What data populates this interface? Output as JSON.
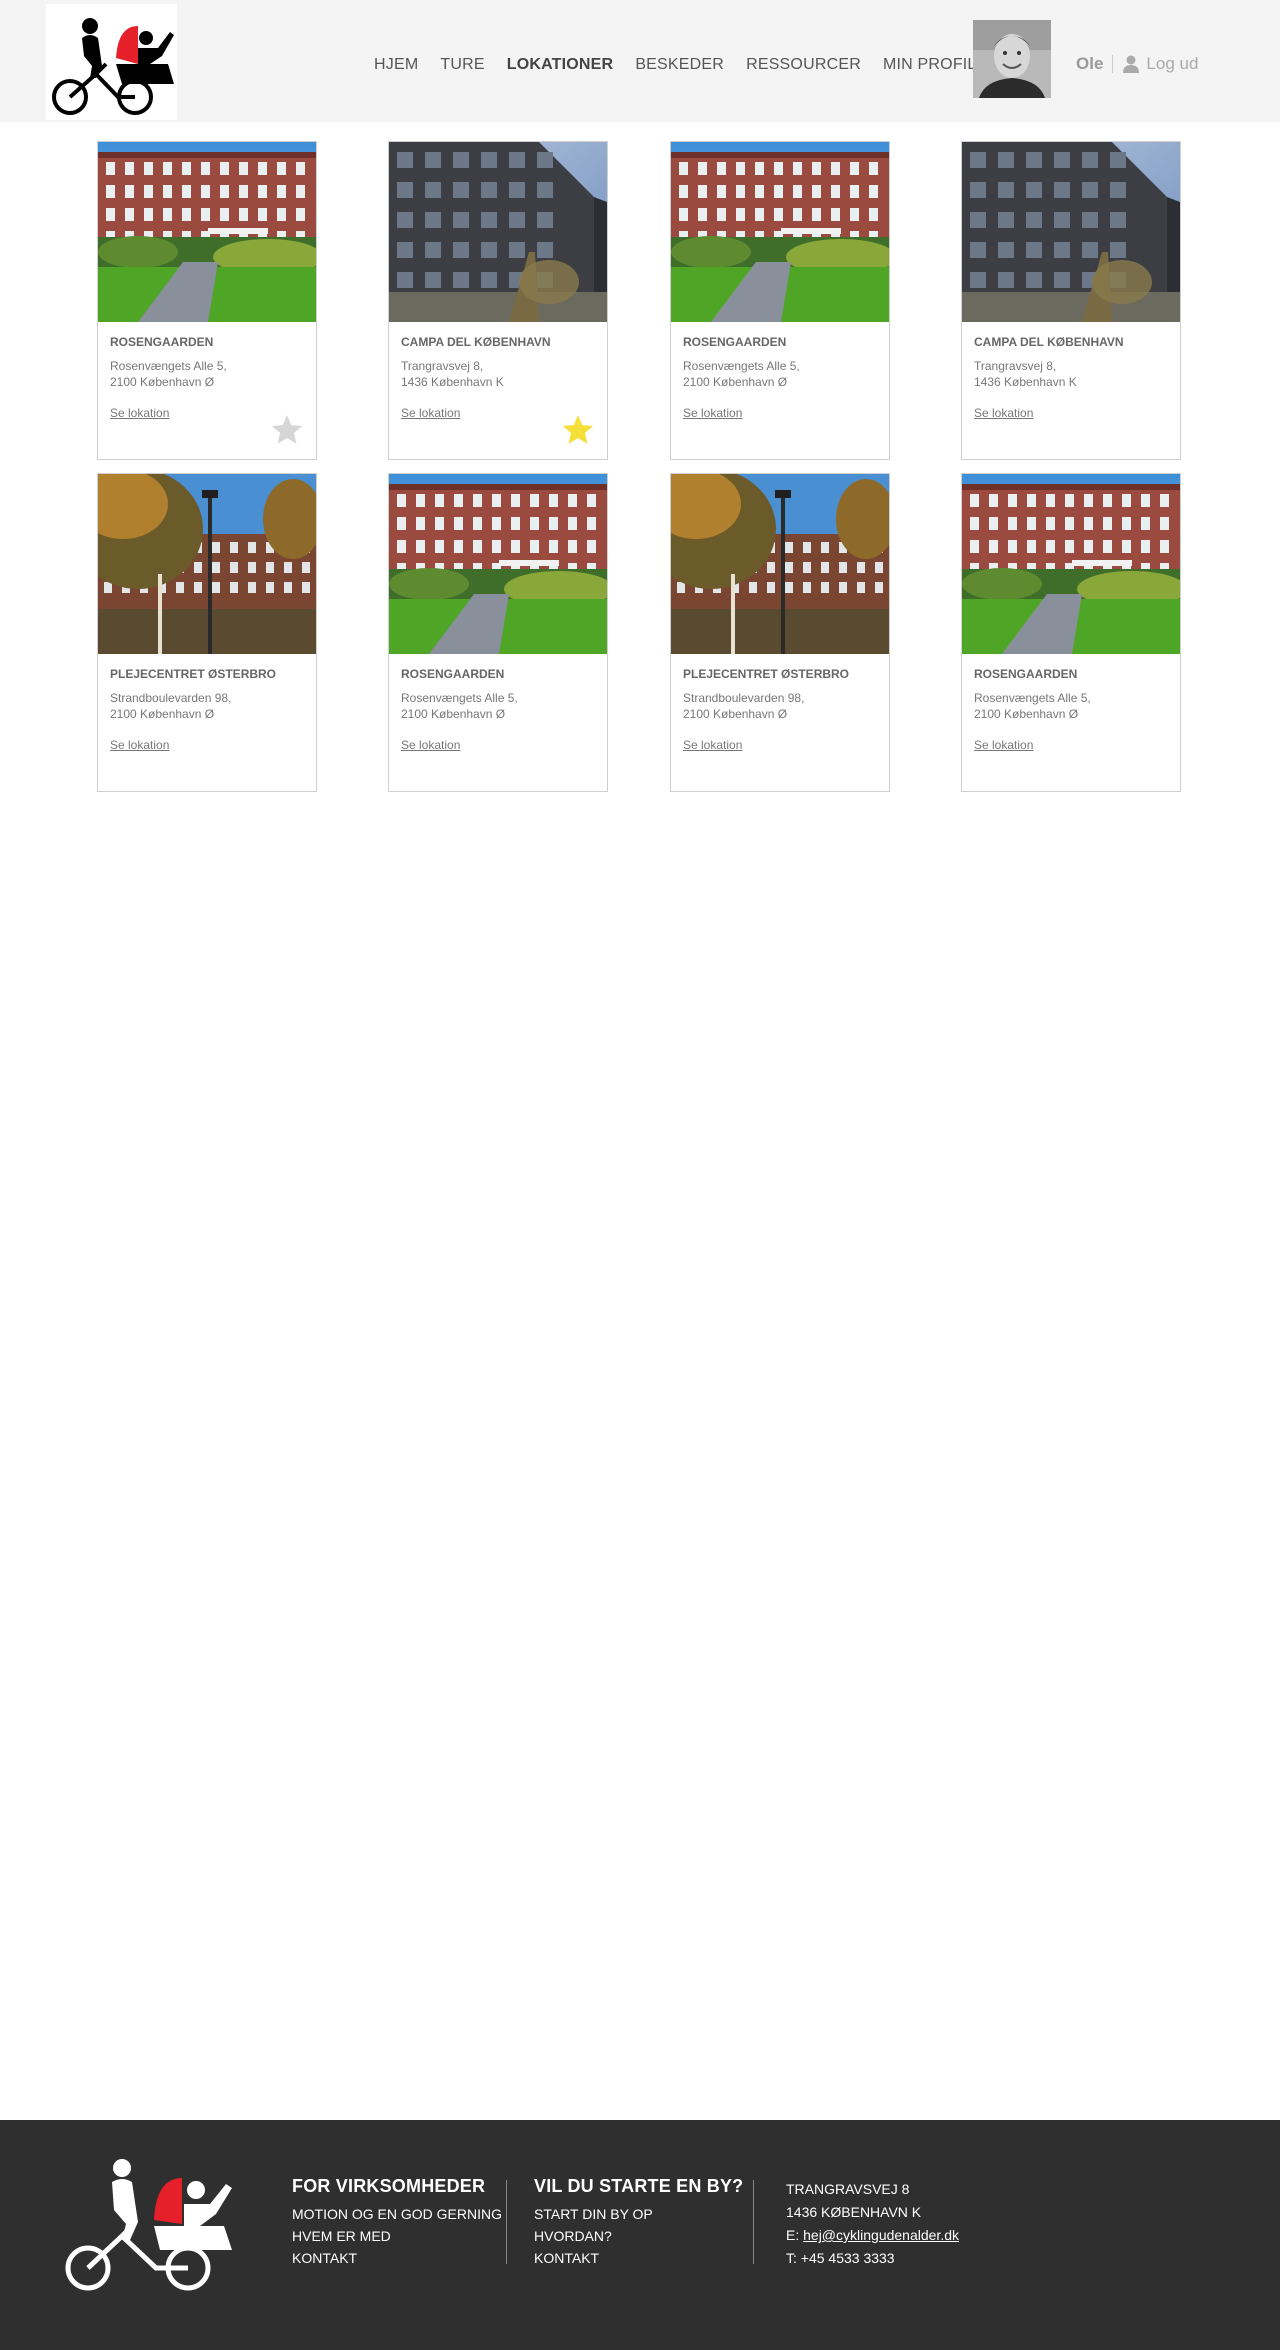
{
  "nav": {
    "items": [
      "HJEM",
      "TURE",
      "LOKATIONER",
      "BESKEDER",
      "RESSOURCER",
      "MIN PROFIL"
    ],
    "active": "LOKATIONER"
  },
  "user": {
    "name": "Ole",
    "logout_label": "Log ud"
  },
  "cards": [
    {
      "name": "ROSENGAARDEN",
      "addr1": "Rosenvængets Alle 5,",
      "addr2": "2100 København Ø",
      "link": "Se lokation",
      "photo": "brick",
      "favorite": "off"
    },
    {
      "name": "CAMPA DEL KØBENHAVN",
      "addr1": "Trangravsvej 8,",
      "addr2": "1436 København K",
      "link": "Se lokation",
      "photo": "modern",
      "favorite": "on"
    },
    {
      "name": "ROSENGAARDEN",
      "addr1": "Rosenvængets Alle 5,",
      "addr2": "2100 København Ø",
      "link": "Se lokation",
      "photo": "brick",
      "favorite": "none"
    },
    {
      "name": "CAMPA DEL KØBENHAVN",
      "addr1": "Trangravsvej 8,",
      "addr2": "1436 København K",
      "link": "Se lokation",
      "photo": "modern",
      "favorite": "none"
    },
    {
      "name": "PLEJECENTRET ØSTERBRO",
      "addr1": "Strandboulevarden 98,",
      "addr2": "2100 København Ø",
      "link": "Se lokation",
      "photo": "autumn",
      "favorite": "none"
    },
    {
      "name": "ROSENGAARDEN",
      "addr1": "Rosenvængets Alle 5,",
      "addr2": "2100 København Ø",
      "link": "Se lokation",
      "photo": "brick",
      "favorite": "none"
    },
    {
      "name": "PLEJECENTRET ØSTERBRO",
      "addr1": "Strandboulevarden 98,",
      "addr2": "2100 København Ø",
      "link": "Se lokation",
      "photo": "autumn",
      "favorite": "none"
    },
    {
      "name": "ROSENGAARDEN",
      "addr1": "Rosenvængets Alle 5,",
      "addr2": "2100 København Ø",
      "link": "Se lokation",
      "photo": "brick",
      "favorite": "none"
    }
  ],
  "footer": {
    "col1": {
      "title": "FOR VIRKSOMHEDER",
      "links": [
        "MOTION OG EN GOD GERNING",
        "HVEM ER MED",
        "KONTAKT"
      ]
    },
    "col2": {
      "title": "VIL DU STARTE EN BY?",
      "links": [
        "START DIN BY OP",
        "HVORDAN?",
        "KONTAKT"
      ]
    },
    "contact": {
      "street": "TRANGRAVSVEJ 8",
      "city": "1436 KØBENHAVN K",
      "email_prefix": "E: ",
      "email": "hej@cyklingudenalder.dk",
      "phone": "T: +45 4533 3333"
    }
  },
  "colors": {
    "star_on": "#f5e03a",
    "star_off": "#d6d6d6",
    "logo_red": "#e5202a",
    "footer_bg": "#2f2f2f"
  }
}
